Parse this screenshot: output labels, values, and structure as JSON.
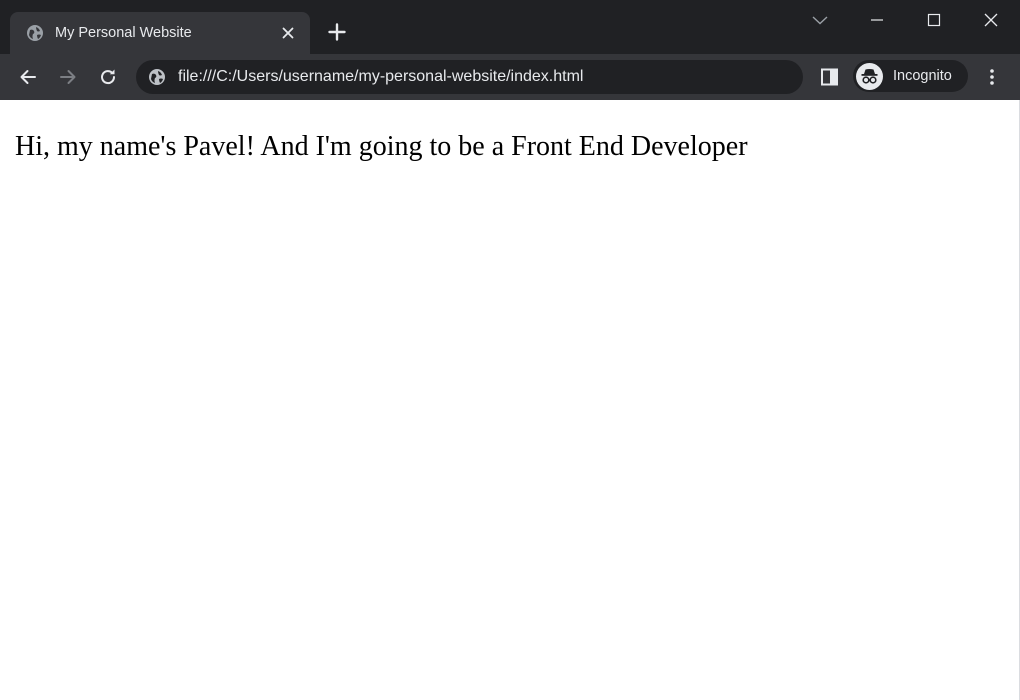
{
  "colors": {
    "tabstrip_bg": "#202124",
    "active_tab_bg": "#35363a",
    "toolbar_bg": "#35363a",
    "omnibox_bg": "#202124",
    "chrome_text": "#e8eaed",
    "page_bg": "#ffffff",
    "page_text": "#000000"
  },
  "tab": {
    "title": "My Personal Website",
    "favicon": "globe-icon",
    "close_icon": "close-icon"
  },
  "tabstrip": {
    "new_tab_icon": "plus-icon",
    "window_controls": [
      "chevron-down-icon",
      "minimize-icon",
      "maximize-icon",
      "close-icon"
    ]
  },
  "toolbar": {
    "back_icon": "arrow-left-icon",
    "forward_icon": "arrow-right-icon",
    "reload_icon": "reload-icon",
    "address": "file:///C:/Users/username/my-personal-website/index.html",
    "address_icon": "globe-icon",
    "side_panel_icon": "side-panel-icon",
    "profile_label": "Incognito",
    "profile_icon": "incognito-icon",
    "menu_icon": "more-vert-icon"
  },
  "page": {
    "heading": "Hi, my name's Pavel! And I'm going to be a Front End Developer"
  }
}
